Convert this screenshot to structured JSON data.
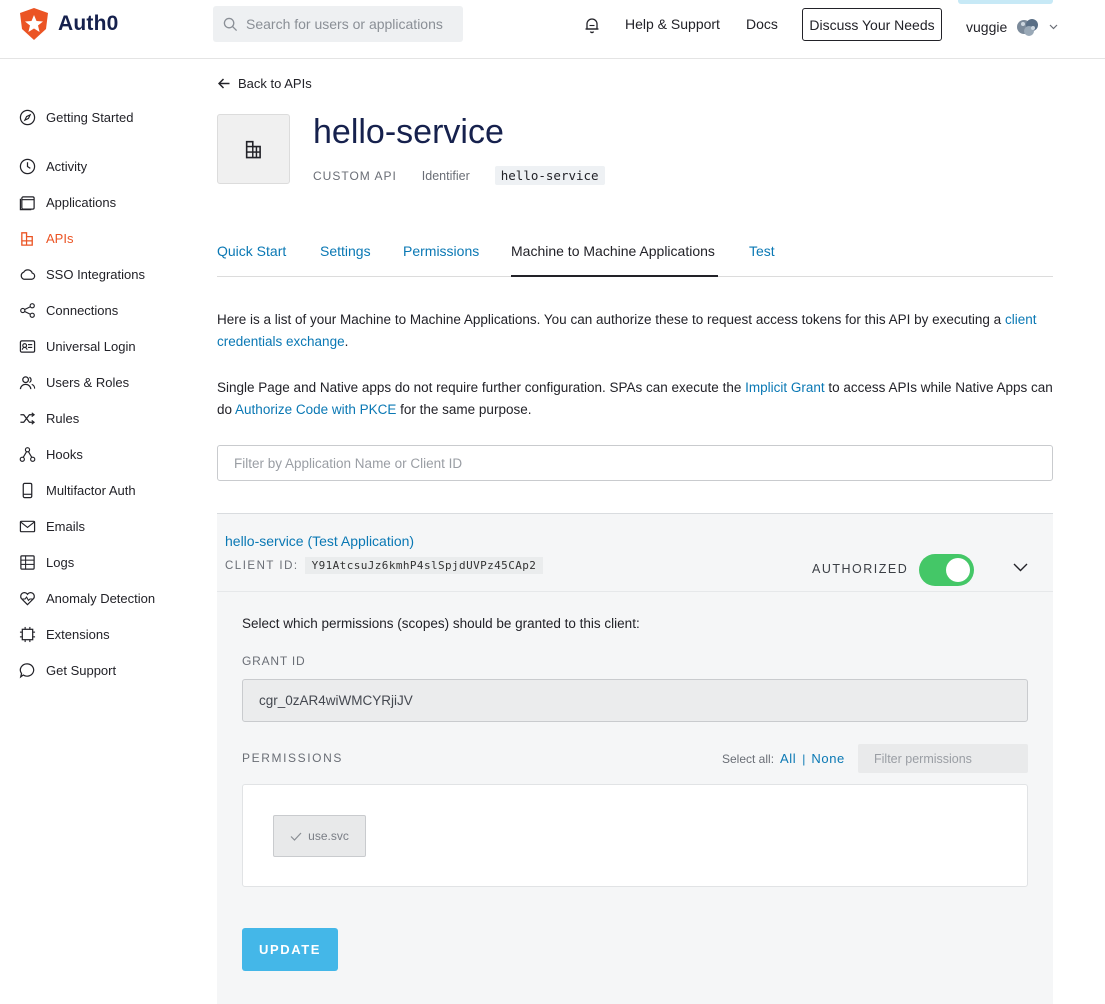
{
  "header": {
    "logo_text": "Auth0",
    "search_placeholder": "Search for users or applications",
    "help_label": "Help & Support",
    "docs_label": "Docs",
    "discuss_label": "Discuss Your Needs",
    "username": "vuggie",
    "brand_color": "#eb5424"
  },
  "sidebar": {
    "items": [
      {
        "label": "Getting Started",
        "icon": "compass-icon",
        "active": false
      },
      {
        "label": "Activity",
        "icon": "activity-icon",
        "active": false
      },
      {
        "label": "Applications",
        "icon": "applications-icon",
        "active": false
      },
      {
        "label": "APIs",
        "icon": "apis-icon",
        "active": true
      },
      {
        "label": "SSO Integrations",
        "icon": "cloud-icon",
        "active": false
      },
      {
        "label": "Connections",
        "icon": "share-icon",
        "active": false
      },
      {
        "label": "Universal Login",
        "icon": "login-icon",
        "active": false
      },
      {
        "label": "Users & Roles",
        "icon": "users-icon",
        "active": false
      },
      {
        "label": "Rules",
        "icon": "shuffle-icon",
        "active": false
      },
      {
        "label": "Hooks",
        "icon": "hooks-icon",
        "active": false
      },
      {
        "label": "Multifactor Auth",
        "icon": "phone-icon",
        "active": false
      },
      {
        "label": "Emails",
        "icon": "mail-icon",
        "active": false
      },
      {
        "label": "Logs",
        "icon": "logs-icon",
        "active": false
      },
      {
        "label": "Anomaly Detection",
        "icon": "heart-icon",
        "active": false
      },
      {
        "label": "Extensions",
        "icon": "chip-icon",
        "active": false
      },
      {
        "label": "Get Support",
        "icon": "chat-icon",
        "active": false
      }
    ]
  },
  "main": {
    "back_label": "Back to APIs",
    "api_name": "hello-service",
    "api_type": "CUSTOM API",
    "identifier_label": "Identifier",
    "identifier_value": "hello-service",
    "tabs": [
      {
        "label": "Quick Start"
      },
      {
        "label": "Settings"
      },
      {
        "label": "Permissions"
      },
      {
        "label": "Machine to Machine Applications"
      },
      {
        "label": "Test"
      }
    ],
    "active_tab": "Machine to Machine Applications",
    "intro1_text": "Here is a list of your Machine to Machine Applications. You can authorize these to request access tokens for this API by executing a",
    "intro1_link": "client credentials exchange",
    "intro1_end": ".",
    "intro2_a": "Single Page and Native apps do not require further configuration. SPAs can execute the",
    "intro2_link1": "Implicit Grant",
    "intro2_b": "to access APIs while Native Apps can do",
    "intro2_link2": "Authorize Code with PKCE",
    "intro2_c": "for the same purpose.",
    "filter_placeholder": "Filter by Application Name or Client ID"
  },
  "app": {
    "name": "hello-service (Test Application)",
    "client_id_label": "CLIENT ID:",
    "client_id": "Y91AtcsuJz6kmhP4slSpjdUVPz45CAp2",
    "status": "AUTHORIZED",
    "authorized": true,
    "scopes_title": "Select which permissions (scopes) should be granted to this client:",
    "grant_label": "GRANT ID",
    "grant_id": "cgr_0zAR4wiWMCYRjiJV",
    "permissions_label": "PERMISSIONS",
    "select_all_label": "Select all:",
    "select_all_link": "All",
    "select_none_link": "None",
    "filter_permissions_placeholder": "Filter permissions",
    "permissions": [
      {
        "name": "use.svc",
        "checked": true
      }
    ],
    "update_label": "UPDATE"
  }
}
